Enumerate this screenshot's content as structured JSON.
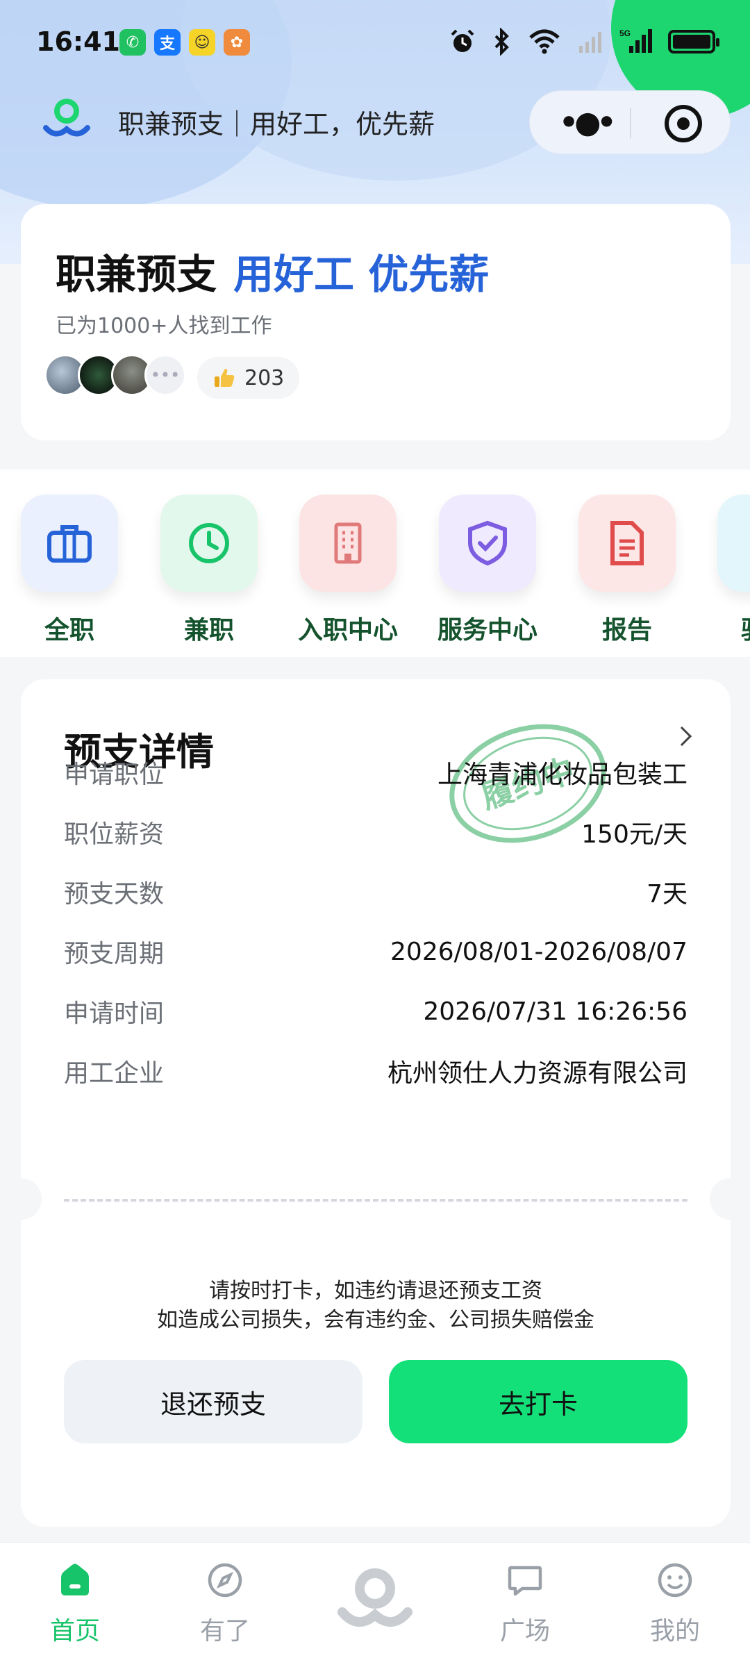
{
  "status_bar": {
    "time": "16:41",
    "app_icons": [
      {
        "name": "wechat-icon",
        "glyph": "✆",
        "color": "#20c161"
      },
      {
        "name": "alipay-icon",
        "glyph": "支",
        "color": "#1677ff"
      },
      {
        "name": "mini-app-icon",
        "glyph": "☺",
        "color": "#f5d327"
      },
      {
        "name": "game-app-icon",
        "glyph": "✿",
        "color": "#f08a3c"
      }
    ],
    "network_label": "5G"
  },
  "header": {
    "title": "职兼预支｜用好工，优先薪"
  },
  "hero": {
    "brand": "职兼预支",
    "slogan": "用好工  优先薪",
    "subtitle": "已为1000+人找到工作",
    "like_count": "203"
  },
  "nav": {
    "items": [
      {
        "label": "全职",
        "icon": "briefcase-icon"
      },
      {
        "label": "兼职",
        "icon": "clock-icon"
      },
      {
        "label": "入职中心",
        "icon": "building-icon"
      },
      {
        "label": "服务中心",
        "icon": "shield-icon"
      },
      {
        "label": "报告",
        "icon": "document-icon"
      },
      {
        "label": "骑手",
        "icon": "rider-icon"
      }
    ]
  },
  "detail": {
    "title": "预支详情",
    "stamp_text": "履约中",
    "rows": [
      {
        "key": "申请职位",
        "value": "上海青浦化妆品包装工"
      },
      {
        "key": "职位薪资",
        "value": "150元/天"
      },
      {
        "key": "预支天数",
        "value": "7天"
      },
      {
        "key": "预支周期",
        "value": "2026/08/01-2026/08/07"
      },
      {
        "key": "申请时间",
        "value": "2026/07/31 16:26:56"
      },
      {
        "key": "用工企业",
        "value": "杭州领仕人力资源有限公司"
      }
    ],
    "notice_line1": "请按时打卡，如违约请退还预支工资",
    "notice_line2": "如造成公司损失，会有违约金、公司损失赔偿金",
    "btn_back": "退还预支",
    "btn_go": "去打卡"
  },
  "tabbar": {
    "items": [
      {
        "label": "首页",
        "icon": "home-icon",
        "active": true
      },
      {
        "label": "有了",
        "icon": "compass-icon",
        "active": false
      },
      {
        "label": "",
        "icon": "center-logo-icon",
        "active": false
      },
      {
        "label": "广场",
        "icon": "chat-bubble-icon",
        "active": false
      },
      {
        "label": "我的",
        "icon": "smile-icon",
        "active": false
      }
    ]
  },
  "colors": {
    "accent_green": "#14e07a",
    "brand_blue": "#2763d8",
    "active_tab": "#18c46a",
    "nav_label": "#14532d"
  }
}
